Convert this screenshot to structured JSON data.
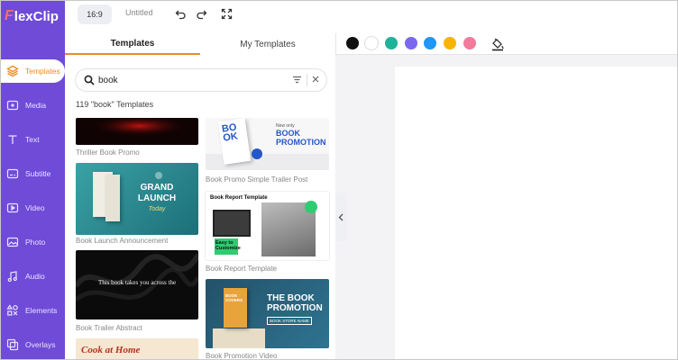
{
  "app": {
    "logo_text": "lexClip",
    "logo_letter": "F"
  },
  "topbar": {
    "ratio_label": "16:9",
    "doc_title": "Untitled"
  },
  "sidebar": {
    "items": [
      {
        "label": "Templates",
        "icon": "layers-icon"
      },
      {
        "label": "Media",
        "icon": "media-icon"
      },
      {
        "label": "Text",
        "icon": "text-icon"
      },
      {
        "label": "Subtitle",
        "icon": "subtitle-icon"
      },
      {
        "label": "Video",
        "icon": "video-icon"
      },
      {
        "label": "Photo",
        "icon": "photo-icon"
      },
      {
        "label": "Audio",
        "icon": "audio-icon"
      },
      {
        "label": "Elements",
        "icon": "elements-icon"
      },
      {
        "label": "Overlays",
        "icon": "overlays-icon"
      }
    ]
  },
  "panel": {
    "tabs": [
      {
        "label": "Templates"
      },
      {
        "label": "My Templates"
      }
    ],
    "search": {
      "value": "book",
      "placeholder": ""
    },
    "result_count": "119 \"book\" Templates",
    "templates": [
      {
        "caption": "Thriller Book Promo"
      },
      {
        "caption": "Book Launch Announcement",
        "line1": "GRAND",
        "line2": "LAUNCH",
        "line3": "Today"
      },
      {
        "caption": "Book Trailer Abstract",
        "line1": "This book takes you across the"
      },
      {
        "caption": "",
        "line1": "Cook at Home"
      },
      {
        "caption": "Book Promo Simple Trailer Post",
        "line1": "BO",
        "line2": "OK",
        "line3": "BOOK",
        "line4": "PROMOTION",
        "line5": "New only"
      },
      {
        "caption": "Book Report Template",
        "line1": "Book Report Template",
        "line2": "Easy to",
        "line3": "Customize"
      },
      {
        "caption": "Book Promotion Video",
        "line1": "THE BOOK",
        "line2": "PROMOTION",
        "line3": "BOOK STORE NAME",
        "line4": "BOOK COVERS"
      }
    ]
  },
  "colors": {
    "swatches": [
      "#111111",
      "#ffffff",
      "#1fb29a",
      "#7b68ee",
      "#2196f3",
      "#f7b500",
      "#f27a9b"
    ],
    "accent": "#f08a24",
    "sidebar_bg": "#6f4bd8"
  }
}
